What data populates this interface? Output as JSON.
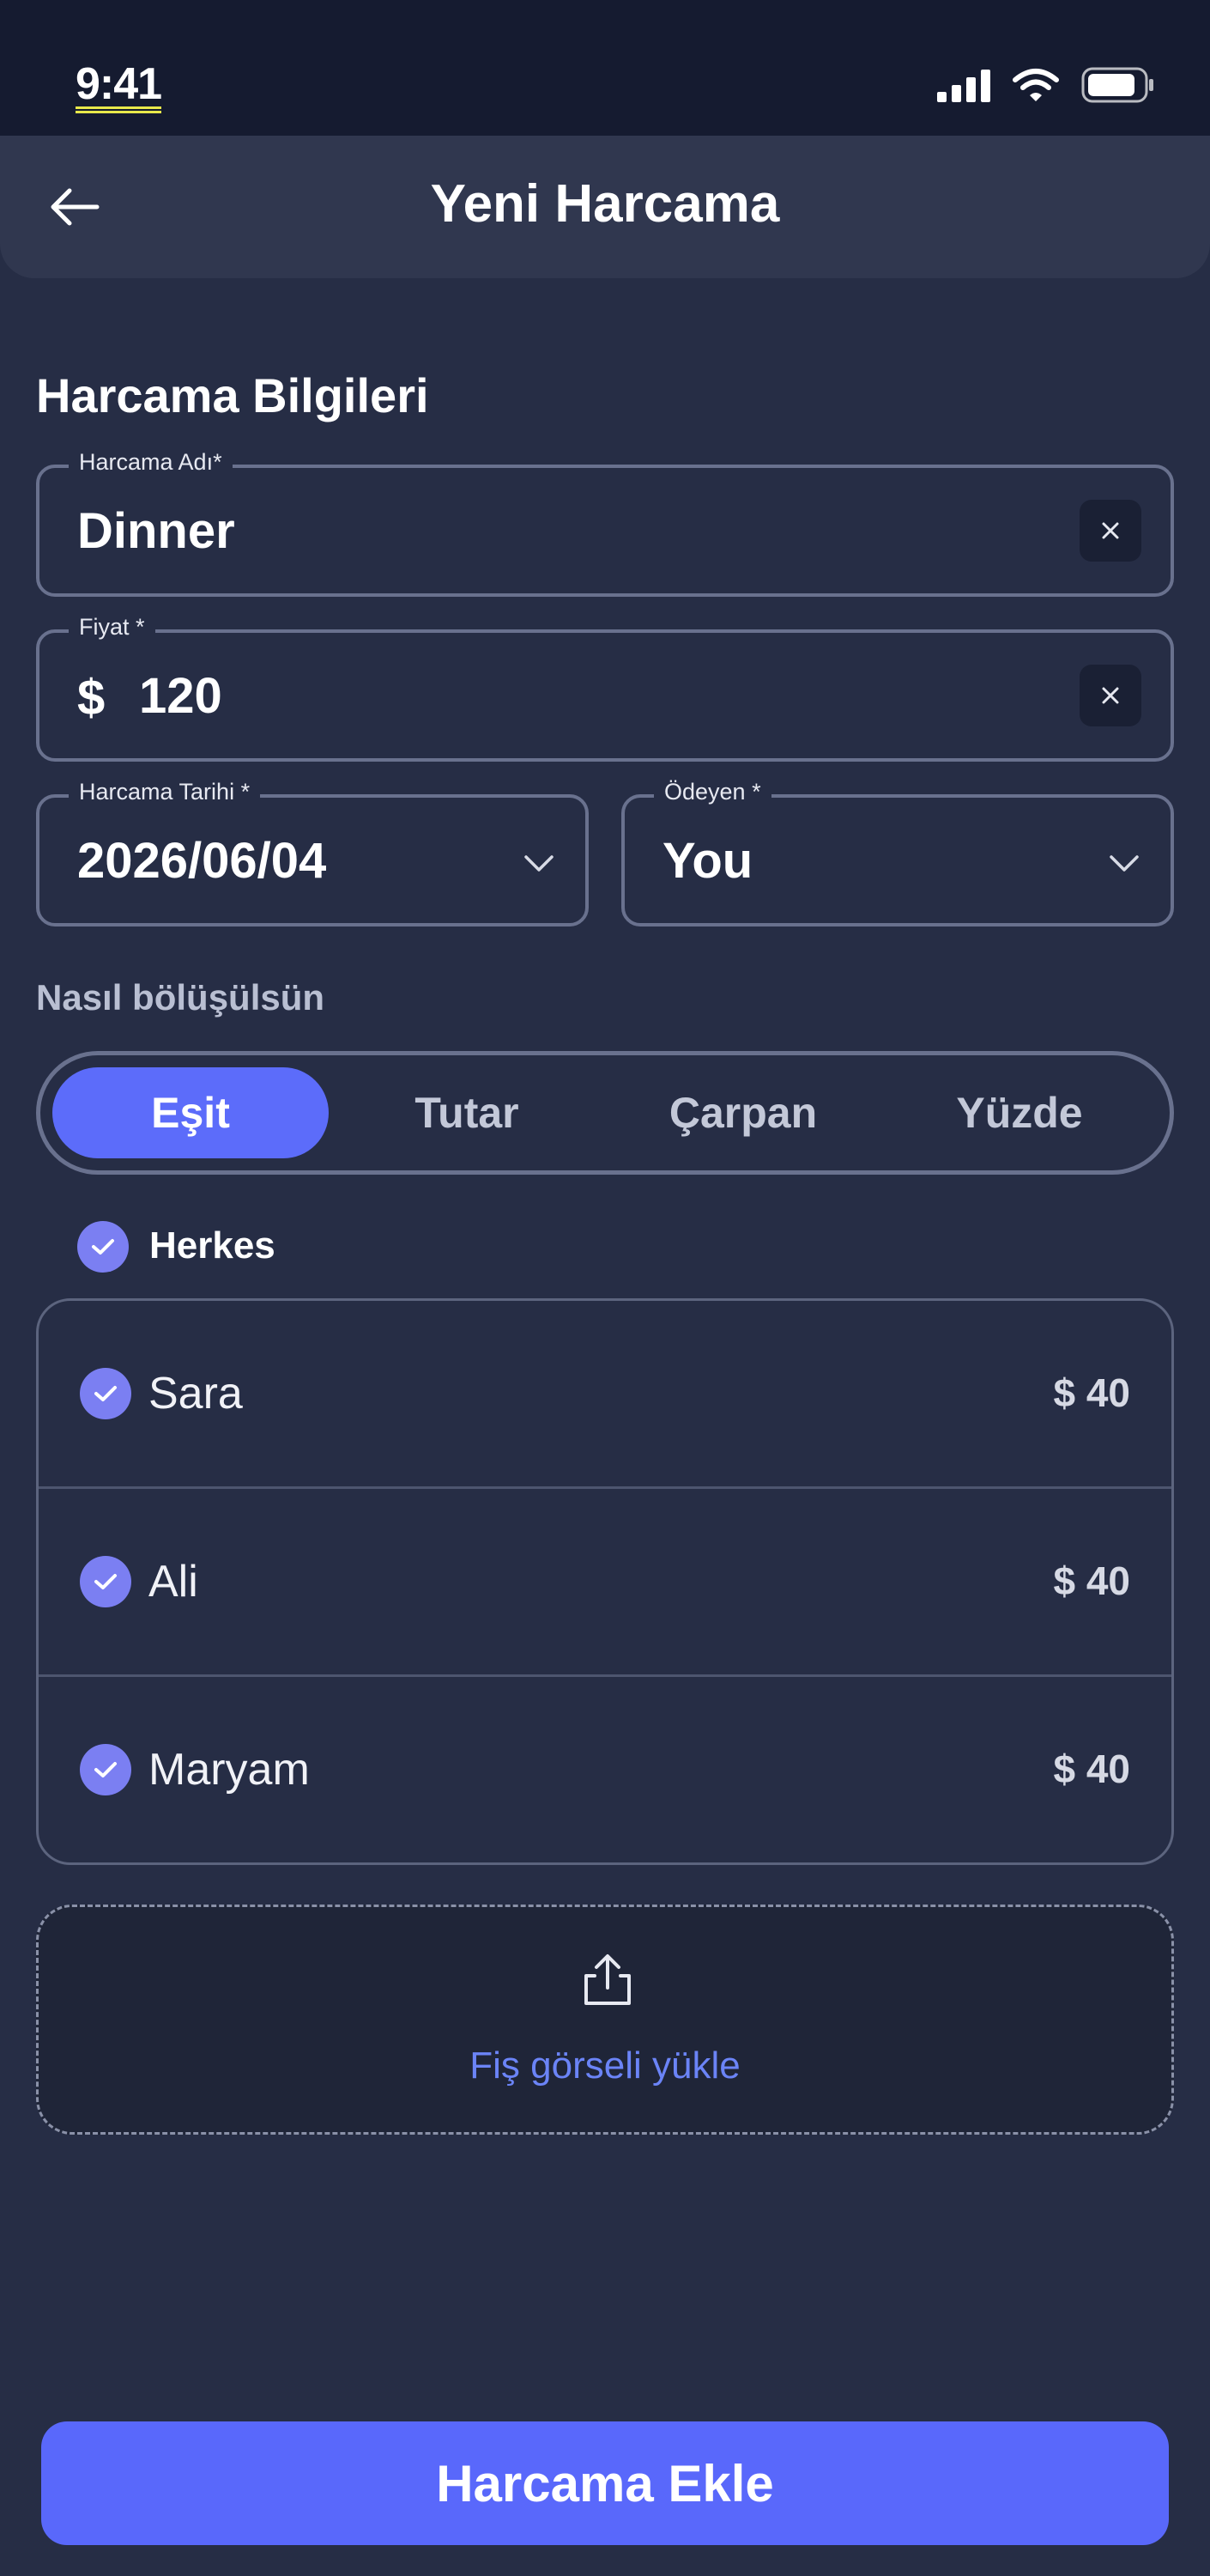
{
  "status_bar": {
    "time": "9:41"
  },
  "header": {
    "title": "Yeni Harcama"
  },
  "form": {
    "section_title": "Harcama Bilgileri",
    "name": {
      "label": "Harcama Adı*",
      "value": "Dinner"
    },
    "price": {
      "label": "Fiyat *",
      "currency": "$",
      "value": "120"
    },
    "date": {
      "label": "Harcama Tarihi *",
      "value": "2026/06/04"
    },
    "payer": {
      "label": "Ödeyen *",
      "value": "You"
    }
  },
  "split": {
    "title": "Nasıl bölüşülsün",
    "tabs": [
      "Eşit",
      "Tutar",
      "Çarpan",
      "Yüzde"
    ],
    "active_tab": "Eşit",
    "all_label": "Herkes",
    "members": [
      {
        "name": "Sara",
        "amount": "$ 40",
        "checked": true
      },
      {
        "name": "Ali",
        "amount": "$ 40",
        "checked": true
      },
      {
        "name": "Maryam",
        "amount": "$ 40",
        "checked": true
      }
    ]
  },
  "upload": {
    "label": "Fiş görseli yükle"
  },
  "submit": {
    "label": "Harcama Ekle"
  },
  "colors": {
    "background": "#262d45",
    "accent": "#5c6cfa",
    "check": "#7b7ff2",
    "link": "#6b84f7"
  }
}
